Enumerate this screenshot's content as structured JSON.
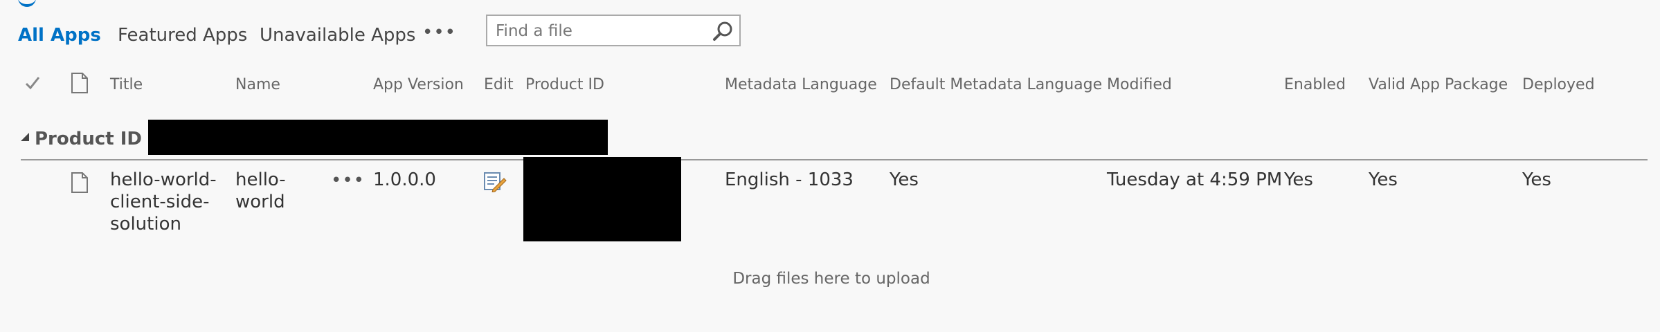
{
  "views": {
    "tabs": [
      "All Apps",
      "Featured Apps",
      "Unavailable Apps"
    ],
    "active_tab": "All Apps",
    "more_glyph": "•••"
  },
  "search": {
    "placeholder": "Find a file",
    "icon": "magnifier-icon"
  },
  "columns": {
    "title": "Title",
    "name": "Name",
    "app_version": "App Version",
    "edit": "Edit",
    "product_id": "Product ID",
    "metadata_language": "Metadata Language",
    "default_metadata_language": "Default Metadata Language",
    "modified": "Modified",
    "enabled": "Enabled",
    "valid_app_package": "Valid App Package",
    "deployed": "Deployed"
  },
  "group": {
    "label": "Product ID :"
  },
  "rows": [
    {
      "title_lines": [
        "hello-world-",
        "client-side-",
        "solution"
      ],
      "name_lines": [
        "hello-",
        "world"
      ],
      "app_version": "1.0.0.0",
      "metadata_language": "English - 1033",
      "default_metadata_language": "Yes",
      "modified": "Tuesday at 4:59 PM",
      "enabled": "Yes",
      "valid_app_package": "Yes",
      "deployed": "Yes"
    }
  ],
  "upload_hint": "Drag files here to upload",
  "colors": {
    "accent": "#0072c6",
    "redaction": "#000000"
  }
}
